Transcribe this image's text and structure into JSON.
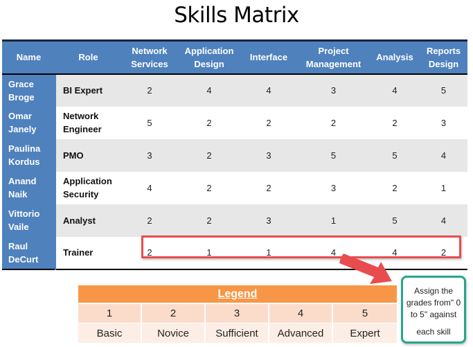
{
  "title": "Skills Matrix",
  "matrix": {
    "columns": {
      "name": "Name",
      "role": "Role",
      "network_services": [
        "Network",
        "Services"
      ],
      "application_design": [
        "Application",
        "Design"
      ],
      "interface": "Interface",
      "project_management": [
        "Project",
        "Management"
      ],
      "analysis": "Analysis",
      "reports_design": [
        "Reports",
        "Design"
      ]
    },
    "rows": [
      {
        "name": [
          "Grace",
          "Broge"
        ],
        "role": [
          "BI Expert"
        ],
        "scores": [
          "2",
          "4",
          "4",
          "3",
          "4",
          "5"
        ]
      },
      {
        "name": [
          "Omar",
          "Janely"
        ],
        "role": [
          "Network",
          "Engineer"
        ],
        "scores": [
          "5",
          "2",
          "2",
          "2",
          "2",
          "3"
        ]
      },
      {
        "name": [
          "Paulina",
          "Kordus"
        ],
        "role": [
          "PMO"
        ],
        "scores": [
          "3",
          "2",
          "3",
          "5",
          "5",
          "4"
        ]
      },
      {
        "name": [
          "Anand",
          "Naik"
        ],
        "role": [
          "Application",
          "Security"
        ],
        "scores": [
          "4",
          "2",
          "2",
          "3",
          "2",
          "1"
        ]
      },
      {
        "name": [
          "Vittorio",
          "Vaile"
        ],
        "role": [
          "Analyst"
        ],
        "scores": [
          "2",
          "2",
          "3",
          "1",
          "5",
          "4"
        ]
      },
      {
        "name": [
          "Raul",
          "DeCurt"
        ],
        "role": [
          "Trainer"
        ],
        "scores": [
          "2",
          "1",
          "1",
          "4",
          "4",
          "2"
        ]
      }
    ],
    "highlighted_row": "Raul DeCurt",
    "highlight_color": "#e84c4f",
    "header_color": "#4f81bd"
  },
  "legend": {
    "title": "Legend",
    "levels": [
      {
        "value": "1",
        "label": "Basic"
      },
      {
        "value": "2",
        "label": "Novice"
      },
      {
        "value": "3",
        "label": "Sufficient"
      },
      {
        "value": "4",
        "label": "Advanced"
      },
      {
        "value": "5",
        "label": "Expert"
      }
    ],
    "header_color": "#f79646"
  },
  "callout": {
    "lines": [
      "Assign the",
      "grades from\" 0",
      "to 5\" against",
      "each skill"
    ],
    "border_color": "#26a58b"
  }
}
